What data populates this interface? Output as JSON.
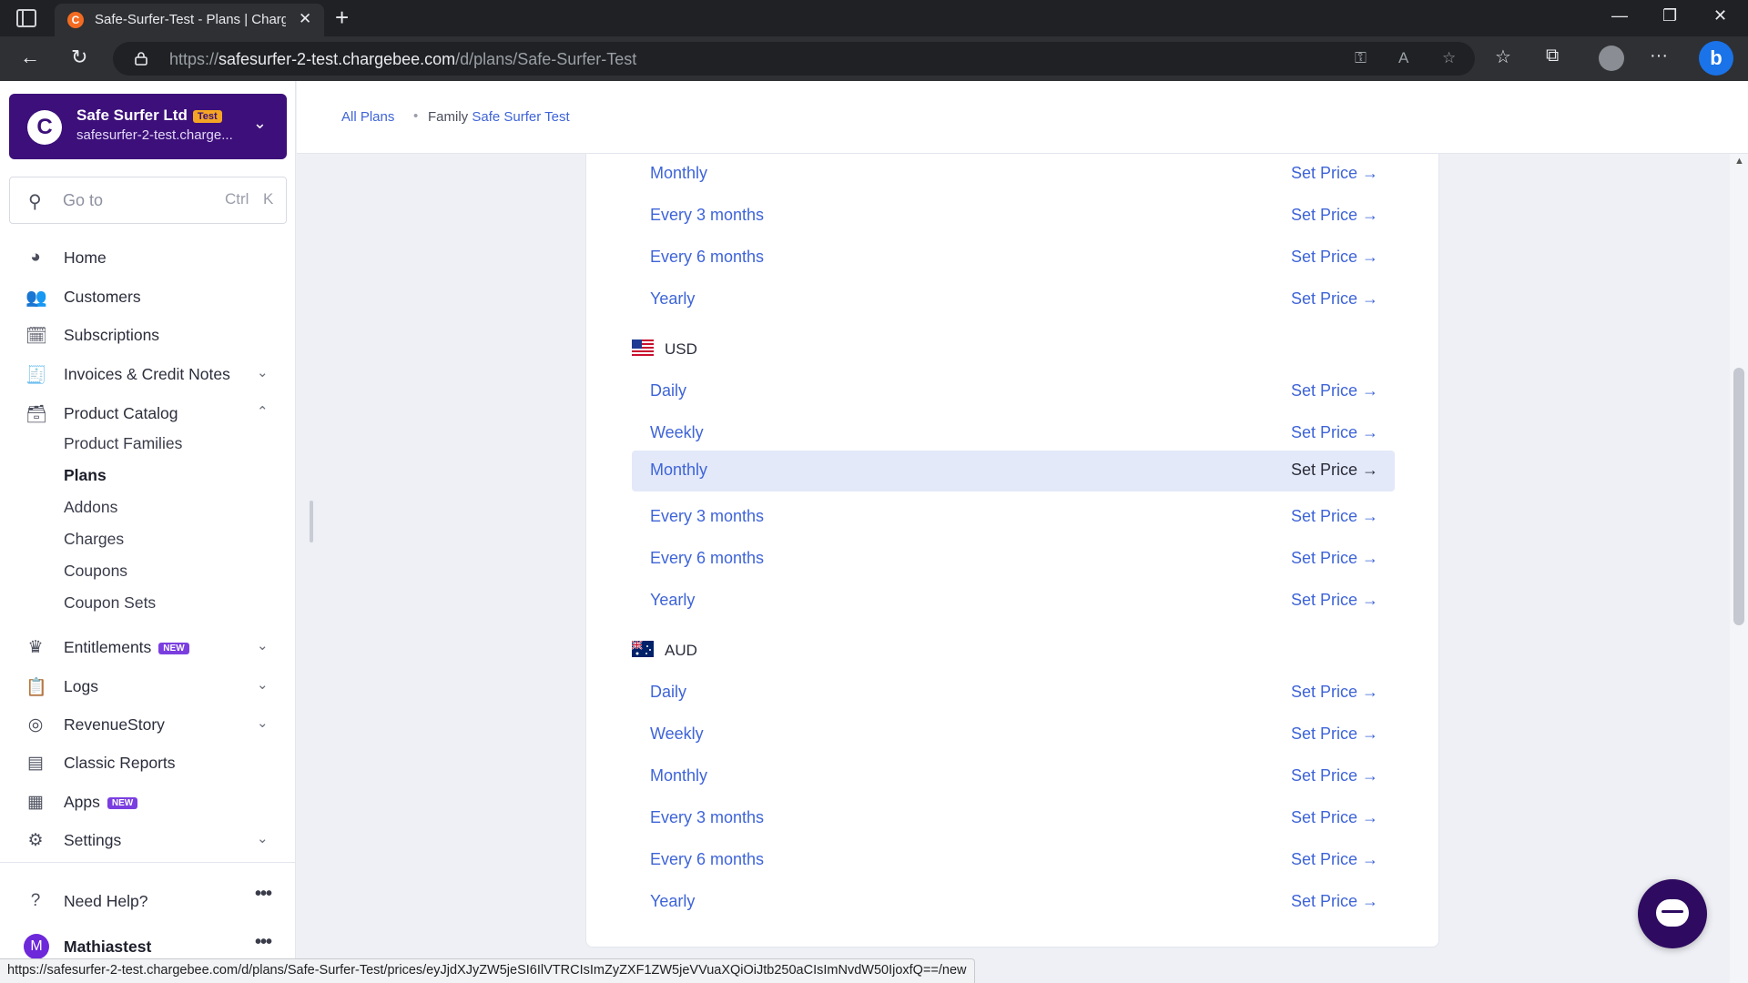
{
  "browser": {
    "tab_title": "Safe-Surfer-Test - Plans | Chargebee",
    "url_prefix": "https://",
    "url_host": "safesurfer-2-test.chargebee.com",
    "url_path": "/d/plans/Safe-Surfer-Test",
    "status_url": "https://safesurfer-2-test.chargebee.com/d/plans/Safe-Surfer-Test/prices/eyJjdXJyZW5jeSI6IlVTRCIsImZyZXF1ZW5jeVVuaXQiOiJtb250aCIsImNvdW50IjoxfQ==/new"
  },
  "org": {
    "name": "Safe Surfer Ltd",
    "badge": "Test",
    "subdomain": "safesurfer-2-test.charge..."
  },
  "search": {
    "placeholder": "Go to",
    "key1": "Ctrl",
    "key2": "K"
  },
  "nav": {
    "home": "Home",
    "customers": "Customers",
    "subscriptions": "Subscriptions",
    "invoices": "Invoices & Credit Notes",
    "product_catalog": "Product Catalog",
    "sub": {
      "product_families": "Product Families",
      "plans": "Plans",
      "addons": "Addons",
      "charges": "Charges",
      "coupons": "Coupons",
      "coupon_sets": "Coupon Sets"
    },
    "entitlements": "Entitlements",
    "entitlements_badge": "NEW",
    "logs": "Logs",
    "revenuestory": "RevenueStory",
    "classic_reports": "Classic Reports",
    "apps": "Apps",
    "apps_badge": "NEW",
    "settings": "Settings",
    "need_help": "Need Help?",
    "user_initial": "M",
    "user_name": "Mathiastest"
  },
  "breadcrumb": {
    "all_plans": "All Plans",
    "family_label": "Family",
    "family_name": "Safe Surfer Test"
  },
  "set_price_label": "Set Price →",
  "top_rows": [
    "Monthly",
    "Every 3 months",
    "Every 6 months",
    "Yearly"
  ],
  "currencies": [
    {
      "code": "USD",
      "rows": [
        "Daily",
        "Weekly",
        "Monthly",
        "Every 3 months",
        "Every 6 months",
        "Yearly"
      ]
    },
    {
      "code": "AUD",
      "rows": [
        "Daily",
        "Weekly",
        "Monthly",
        "Every 3 months",
        "Every 6 months",
        "Yearly"
      ]
    }
  ]
}
